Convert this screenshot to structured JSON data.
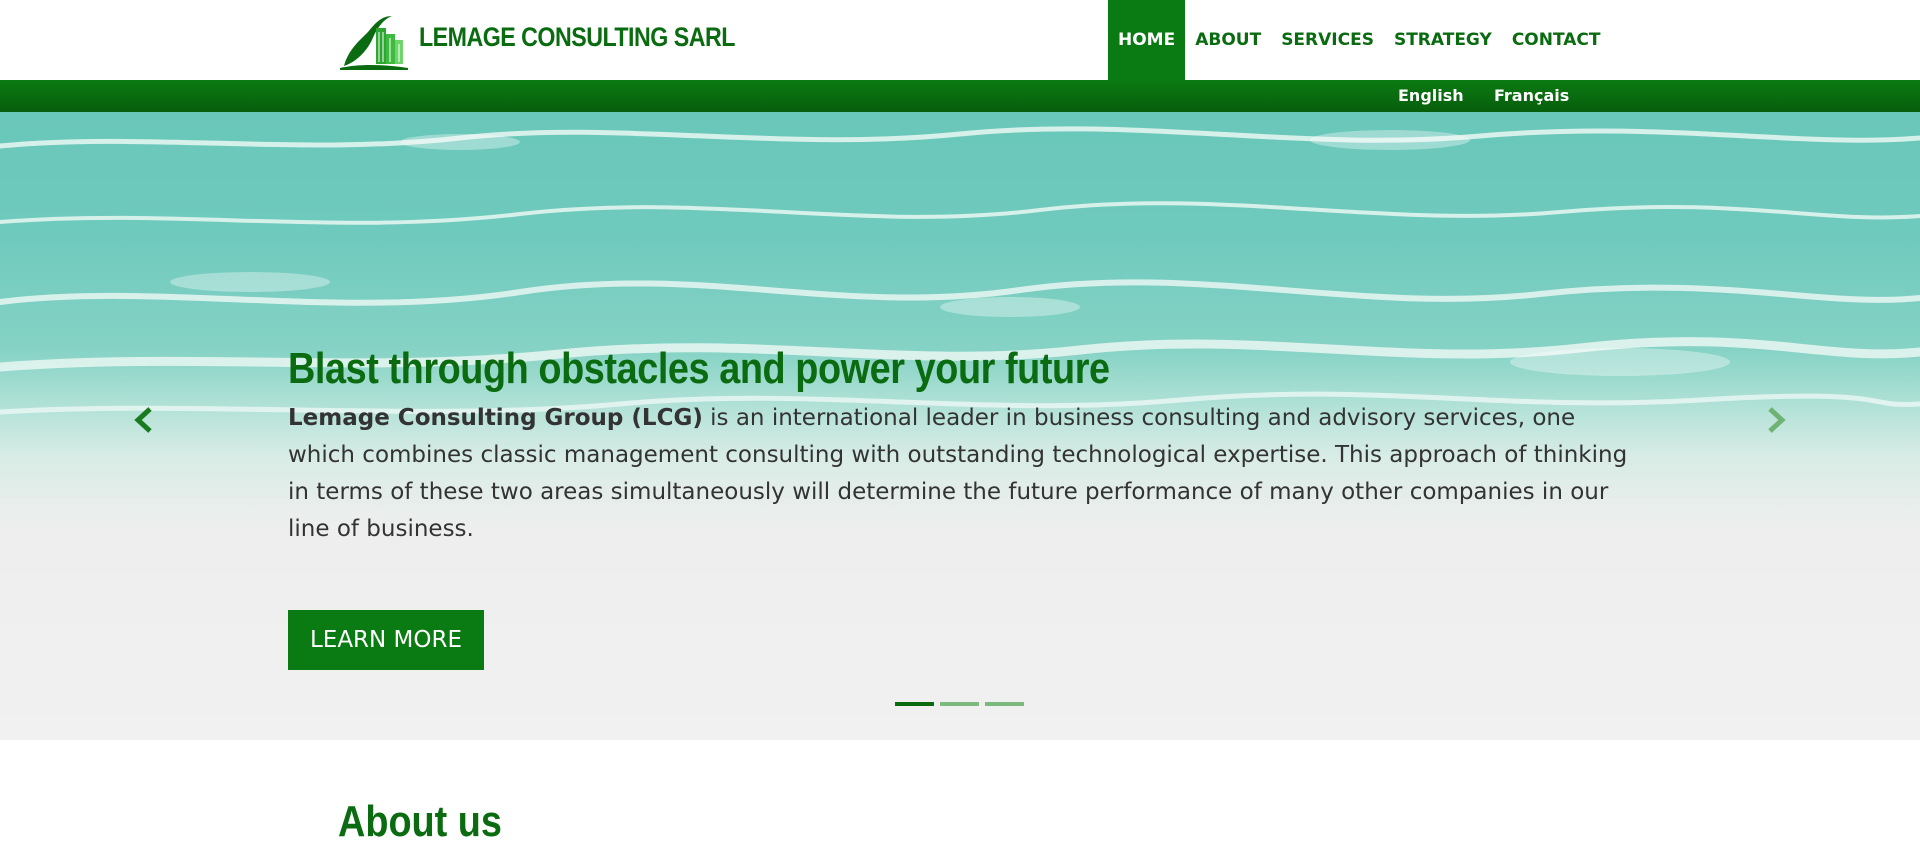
{
  "brand": {
    "name": "LEMAGE CONSULTING SARL",
    "logo_icon": "lcg-building-logo"
  },
  "nav": {
    "items": [
      {
        "label": "HOME",
        "active": true
      },
      {
        "label": "ABOUT",
        "active": false
      },
      {
        "label": "SERVICES",
        "active": false
      },
      {
        "label": "STRATEGY",
        "active": false
      },
      {
        "label": "CONTACT",
        "active": false
      }
    ]
  },
  "languages": [
    "English",
    "Français"
  ],
  "hero": {
    "title": "Blast through obstacles and power your future",
    "text_bold": "Lemage Consulting Group (LCG)",
    "text_rest": " is an international leader in business consulting and advisory services, one which combines classic management consulting with outstanding technological expertise. This approach of thinking in terms of these two areas simultaneously will determine the future performance of many other companies in our line of business.",
    "button_label": "LEARN MORE",
    "slide_count": 3,
    "active_slide": 1
  },
  "about": {
    "title": "About us"
  },
  "colors": {
    "brand_green": "#0a6b10",
    "bar_green": "#0a7a12",
    "inactive_indicator": "#7cb97f"
  }
}
